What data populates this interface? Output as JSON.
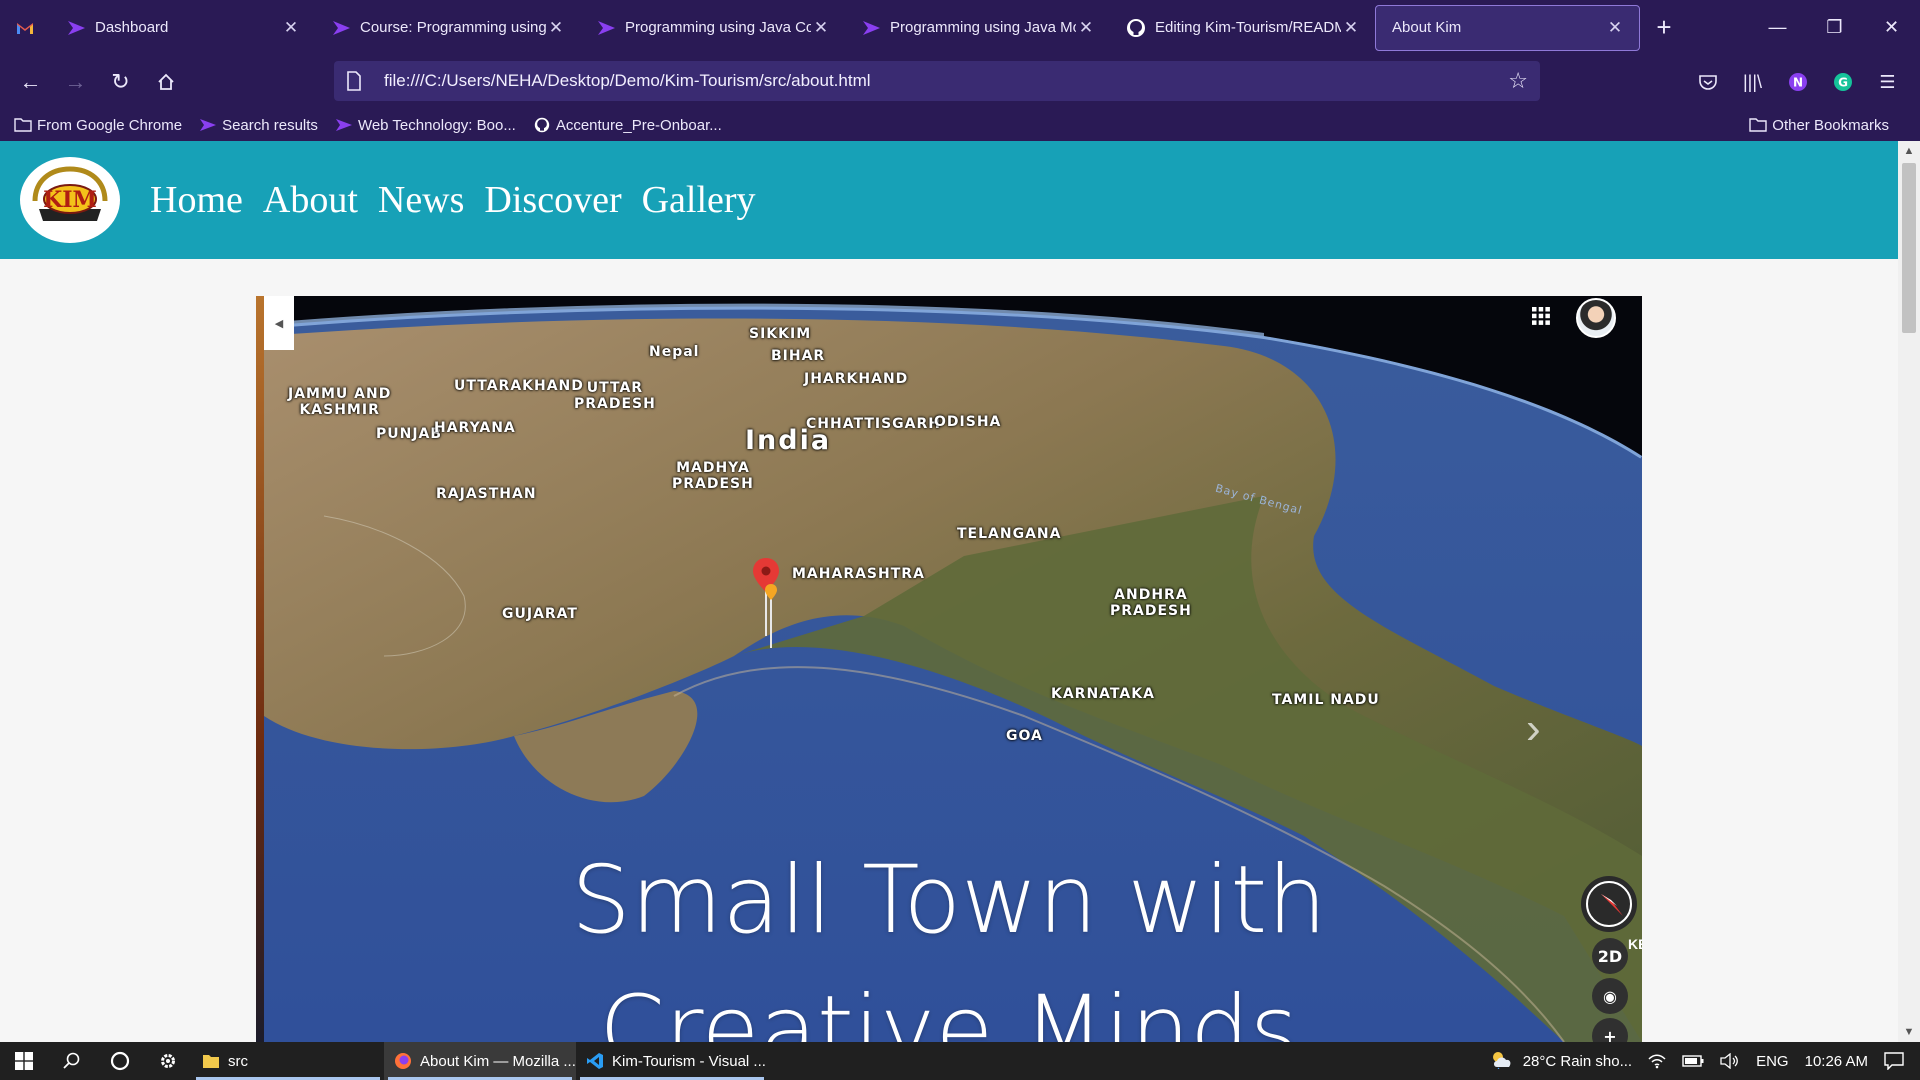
{
  "tabs": [
    {
      "label": "Dashboard",
      "icon": "course-icon",
      "active": false
    },
    {
      "label": "Course: Programming using J",
      "icon": "course-icon",
      "active": false
    },
    {
      "label": "Programming using Java Con",
      "icon": "course-icon",
      "active": false
    },
    {
      "label": "Programming using Java Mo",
      "icon": "course-icon",
      "active": false
    },
    {
      "label": "Editing Kim-Tourism/READM",
      "icon": "github-icon",
      "active": false
    },
    {
      "label": "About Kim",
      "icon": "none",
      "active": true
    }
  ],
  "url": "file:///C:/Users/NEHA/Desktop/Demo/Kim-Tourism/src/about.html",
  "bookmarks": [
    {
      "label": "From Google Chrome",
      "icon": "folder-icon"
    },
    {
      "label": "Search results",
      "icon": "course-icon"
    },
    {
      "label": "Web Technology: Boo...",
      "icon": "course-icon"
    },
    {
      "label": "Accenture_Pre-Onboar...",
      "icon": "github-icon"
    }
  ],
  "bookmarks_other": "Other Bookmarks",
  "site": {
    "logo_text": "KIM",
    "nav": [
      "Home",
      "About",
      "News",
      "Discover",
      "Gallery"
    ]
  },
  "map": {
    "country": "India",
    "labels": {
      "sikkim": "SIKKIM",
      "nepal": "Nepal",
      "bihar": "BIHAR",
      "jharkhand": "JHARKHAND",
      "jammu": "JAMMU AND",
      "kashmir": "KASHMIR",
      "uttarakhand": "UTTARAKHAND",
      "uttar": "UTTAR",
      "pradesh_up": "PRADESH",
      "punjab": "PUNJAB",
      "haryana": "HARYANA",
      "chhattisgarh": "CHHATTISGARH",
      "odisha": "ODISHA",
      "madhya": "MADHYA",
      "pradesh_mp": "PRADESH",
      "rajasthan": "RAJASTHAN",
      "telangana": "TELANGANA",
      "maharashtra": "MAHARASHTRA",
      "gujarat": "GUJARAT",
      "andhra": "ANDHRA",
      "pradesh_ap": "PRADESH",
      "karnataka": "KARNATAKA",
      "tamil_nadu": "TAMIL NADU",
      "goa": "GOA",
      "bay": "Bay of Bengal"
    },
    "btn_2d": "2D",
    "side_text": "KE"
  },
  "hero": {
    "line1": "Small Town with",
    "line2": "Creative Minds"
  },
  "taskbar": {
    "apps": [
      {
        "label": "src",
        "icon": "folder-icon",
        "active": false
      },
      {
        "label": "About Kim — Mozilla ...",
        "icon": "firefox-icon",
        "active": true
      },
      {
        "label": "Kim-Tourism - Visual ...",
        "icon": "vscode-icon",
        "active": false
      }
    ],
    "weather": "28°C  Rain sho...",
    "lang": "ENG",
    "time": "10:26 AM"
  }
}
